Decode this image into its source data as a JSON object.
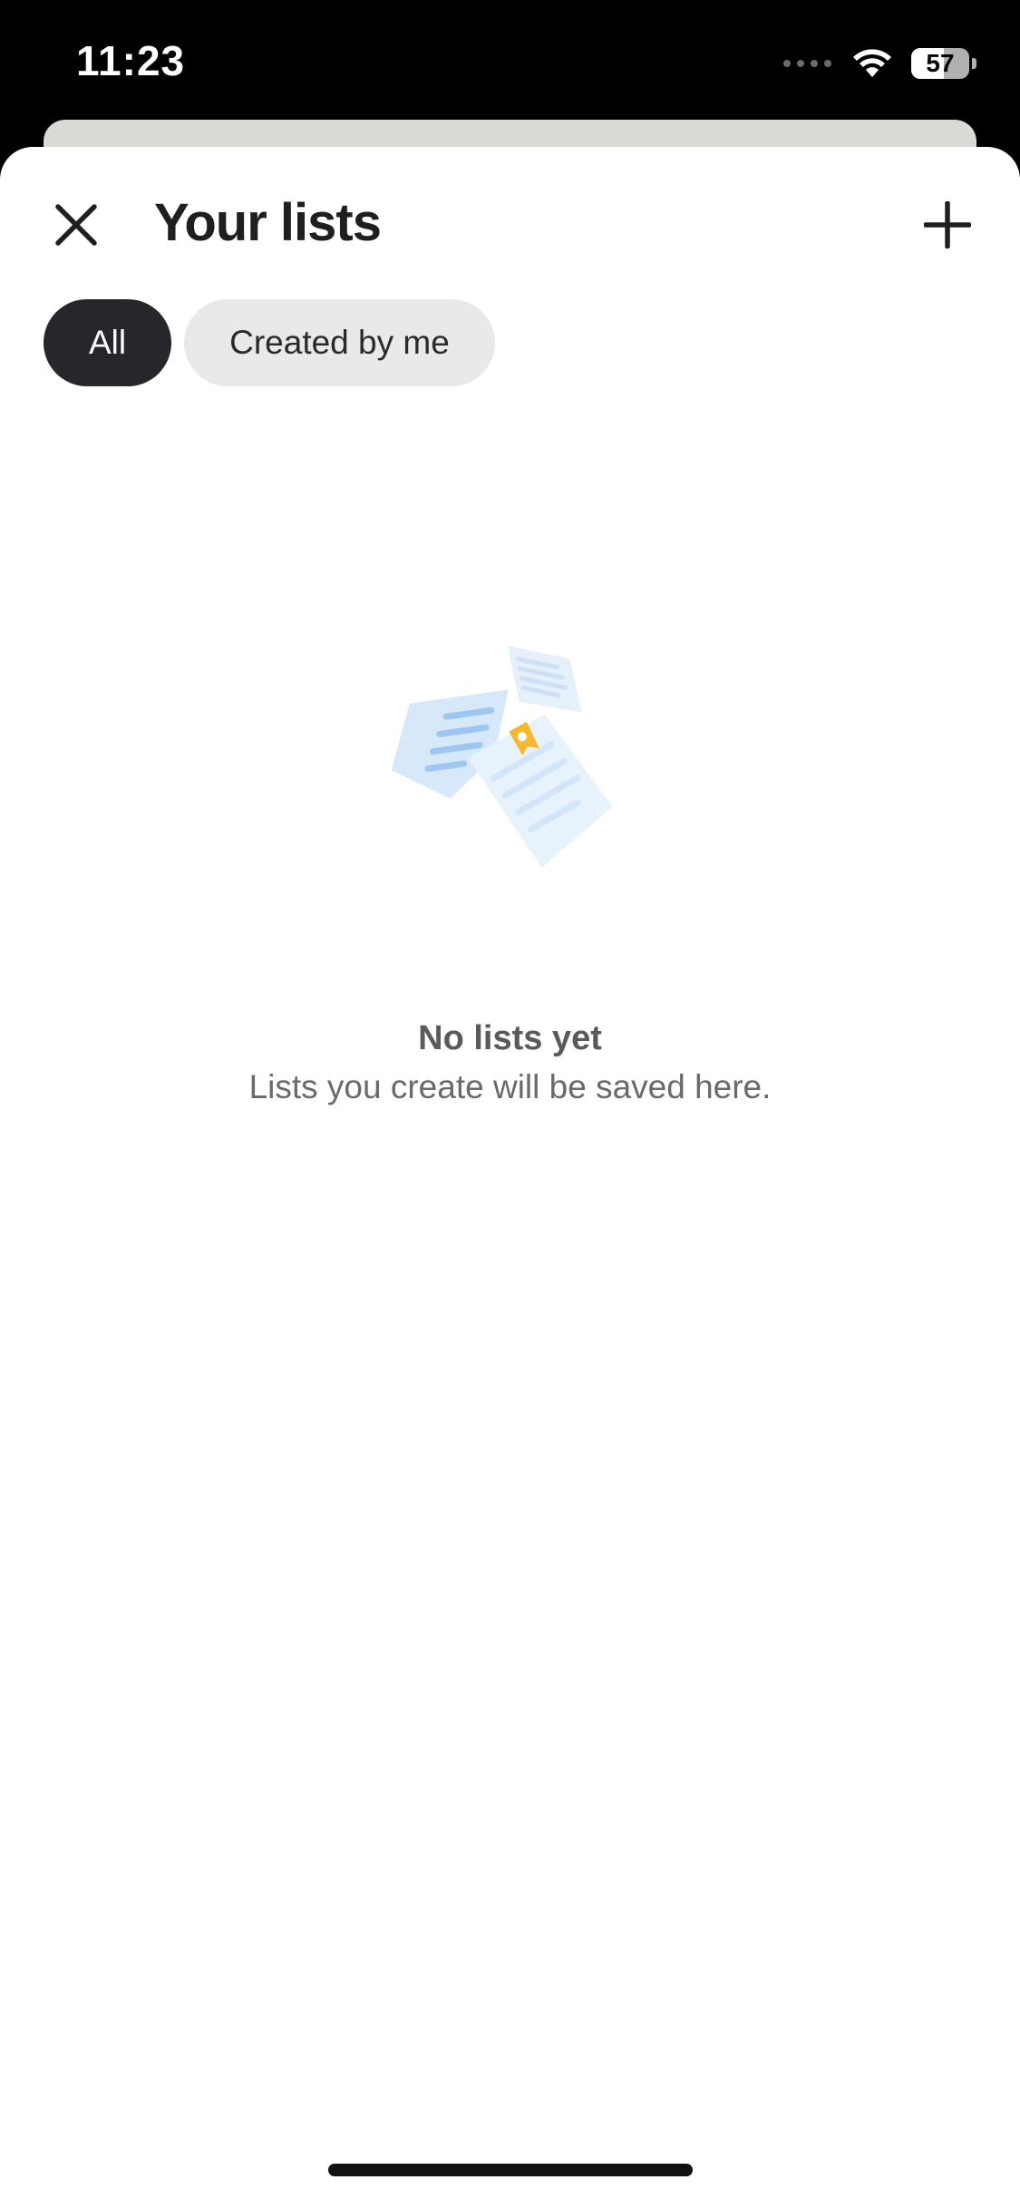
{
  "status_bar": {
    "time": "11:23",
    "battery_level": "57",
    "icons": [
      "cellular-signal-icon",
      "wifi-icon",
      "battery-icon"
    ]
  },
  "sheet": {
    "title": "Your lists",
    "close_icon": "close-icon",
    "add_icon": "plus-icon"
  },
  "filters": {
    "chips": [
      {
        "label": "All",
        "selected": true
      },
      {
        "label": "Created by me",
        "selected": false
      }
    ]
  },
  "empty_state": {
    "illustration": "floating-lists-illustration",
    "title": "No lists yet",
    "subtitle": "Lists you create will be saved here."
  },
  "colors": {
    "accent_dark": "#25272b",
    "chip_inactive": "#e8e9ea",
    "illustration_blue": "#a9cdf4",
    "bookmark_yellow": "#f5b82e"
  }
}
